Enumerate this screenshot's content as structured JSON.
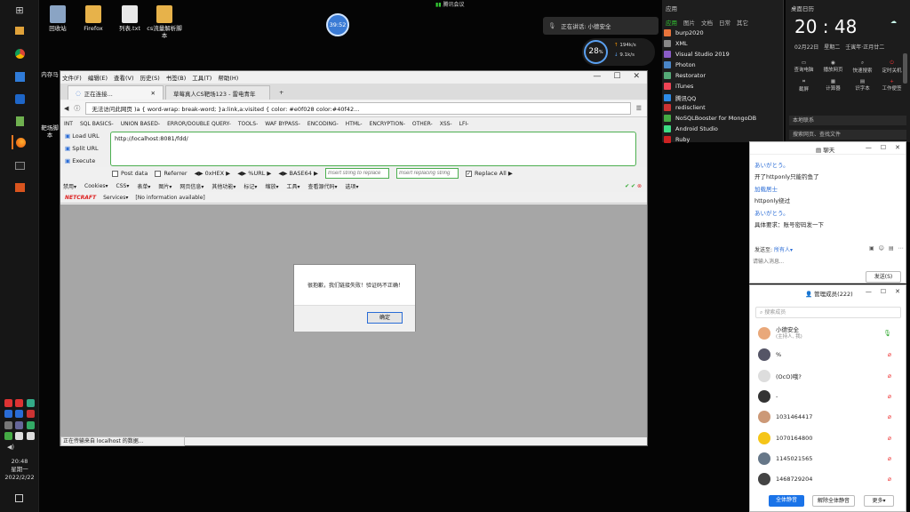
{
  "taskbar": {
    "clock_time": "20:48",
    "clock_day": "星期一",
    "clock_date": "2022/2/22"
  },
  "desktop": {
    "icons": [
      {
        "label": "回收站"
      },
      {
        "label": "Firefox"
      },
      {
        "label": "列表.txt"
      },
      {
        "label": "cs流量解析脚本"
      },
      {
        "label": "内存马"
      },
      {
        "label": "靶场脚本"
      }
    ]
  },
  "meeting": {
    "top_label": "腾讯会议",
    "timer": "39:52",
    "speaking": "正在讲话: 小德安全",
    "net_percent": "28",
    "net_unit": "%",
    "net_up": "194k/s",
    "net_down": "9.1k/s"
  },
  "browser": {
    "menu": [
      "文件(F)",
      "编辑(E)",
      "查看(V)",
      "历史(S)",
      "书签(B)",
      "工具(T)",
      "帮助(H)"
    ],
    "tabs": [
      {
        "label": "正在连接..."
      },
      {
        "label": "草莓真人CS靶场123 - 雷电青年"
      }
    ],
    "url": "无法访问此网页 )a { word-wrap: break-word; }a:link,a:visited { color: #e0f028 color:#40f42...",
    "hackbar_menu": [
      "INT",
      "SQL BASICS-",
      "UNION BASED-",
      "ERROR/DOUBLE QUERY-",
      "TOOLS-",
      "WAF BYPASS-",
      "ENCODING-",
      "HTML-",
      "ENCRYPTION-",
      "OTHER-",
      "XSS-",
      "LFI-"
    ],
    "load_url": "Load URL",
    "split_url": "Split URL",
    "execute": "Execute",
    "hackbar_url": "http://localhost:8081/fdd/",
    "opt_post": "Post data",
    "opt_referrer": "Referrer",
    "opt_hex": "0xHEX",
    "opt_url": "%URL",
    "opt_base64": "BASE64",
    "replace_ph": "Insert string to replace",
    "replacing_ph": "Insert replacing string",
    "opt_replace_all": "Replace All",
    "webdev": [
      "禁用▾",
      "Cookies▾",
      "CSS▾",
      "表单▾",
      "图片▾",
      "网页信息▾",
      "其他功能▾",
      "标记▾",
      "缩放▾",
      "工具▾",
      "查看源代码▾",
      "选项▾"
    ],
    "netcraft": "NETCRAFT",
    "services": "Services▾",
    "no_info": "[No information available]",
    "status": "正在传输来自 localhost 的数据...",
    "dialog_message": "很抱歉，我们链接失败！验证码不正确！",
    "dialog_ok": "确定"
  },
  "apps_menu": {
    "tabs": [
      "应用",
      "图片",
      "文档",
      "日常",
      "其它"
    ],
    "header": "应用",
    "items": [
      "burp2020",
      "XML",
      "Visual Studio 2019",
      "Photon",
      "Restorator",
      "iTunes",
      "腾讯QQ",
      "redisclient",
      "NoSQLBooster for MongoDB",
      "Android Studio",
      "Ruby"
    ]
  },
  "clock_panel": {
    "header": "桌面日历",
    "time": "20 : 48",
    "date": "02月22日",
    "weekday": "星期二",
    "lunar": "壬寅年·正月廿二",
    "quick": [
      "查询电脑",
      "播放网页",
      "快速搜索",
      "定时关机",
      "截屏",
      "计算器",
      "识字本",
      "工作便签"
    ],
    "search1": "本地联系",
    "search2": "搜索网页、查找文件"
  },
  "chat": {
    "title": "聊天",
    "messages": [
      {
        "who": "あいがとう。",
        "text": "开了httponly只能钓鱼了"
      },
      {
        "who": "加载居士",
        "text": "httponly绕过"
      },
      {
        "who": "あいがとう。",
        "text": "具体要求：账号密码发一下"
      }
    ],
    "send_to_label": "发送至:",
    "send_to_value": "所有人▾",
    "input_ph": "请输入消息...",
    "send_btn": "发送(S)"
  },
  "members": {
    "title": "管理成员(222)",
    "search_ph": "搜索成员",
    "list": [
      {
        "name": "小德安全",
        "sub": "(主持人, 我)"
      },
      {
        "name": "%",
        "sub": ""
      },
      {
        "name": "(OcO)哦?",
        "sub": ""
      },
      {
        "name": "-",
        "sub": ""
      },
      {
        "name": "1031464417",
        "sub": ""
      },
      {
        "name": "1070164800",
        "sub": ""
      },
      {
        "name": "1145021565",
        "sub": ""
      },
      {
        "name": "1468729204",
        "sub": ""
      }
    ],
    "btn_mute_all": "全体静音",
    "btn_unmute_all": "解除全体静音",
    "btn_more": "更多▾"
  },
  "colors": {
    "accent_blue": "#1a73e8",
    "hackbar_green": "#4caf50",
    "mute_red": "#e33333"
  }
}
